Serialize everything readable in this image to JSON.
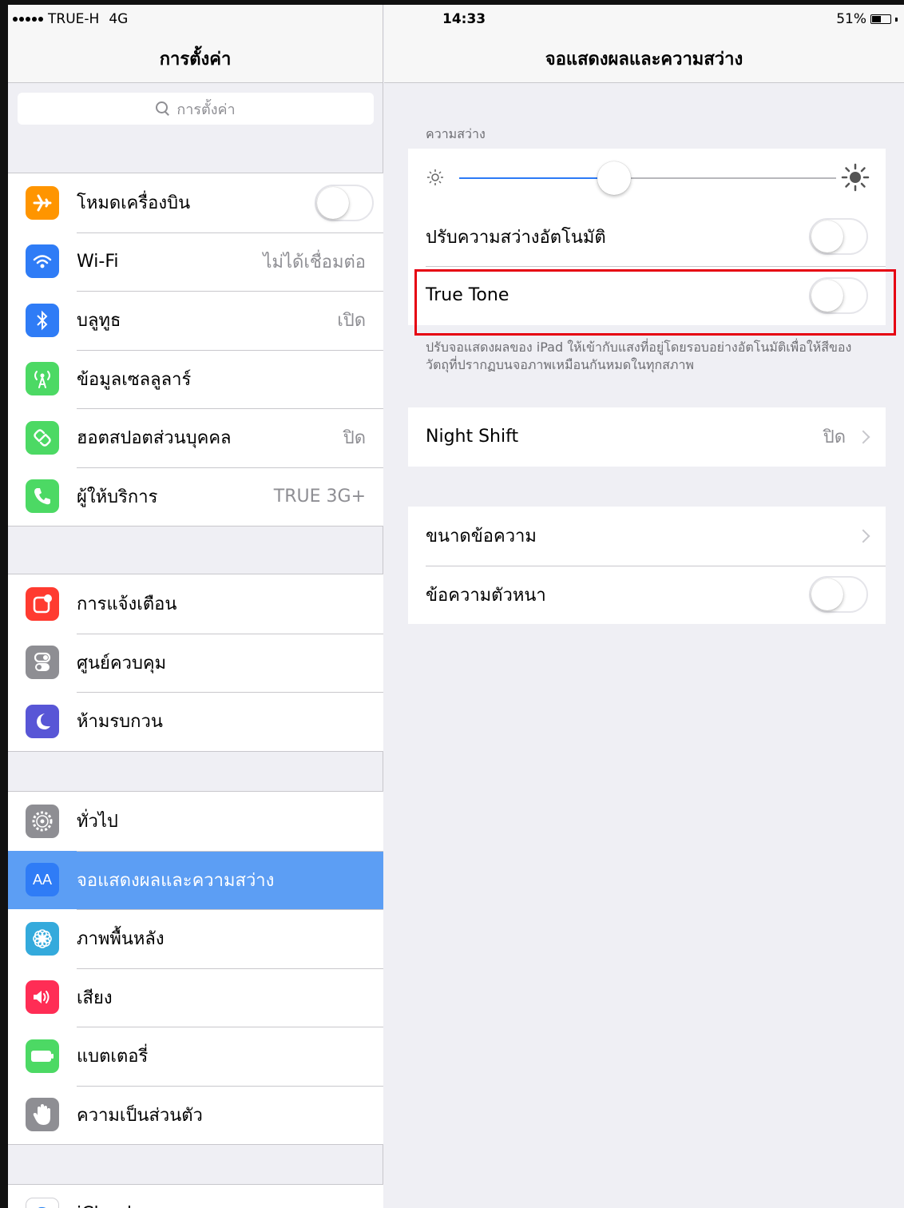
{
  "status_bar": {
    "carrier": "TRUE-H",
    "network": "4G",
    "time": "14:33",
    "battery": "51%",
    "battery_level": 0.51
  },
  "sidebar": {
    "title": "การตั้งค่า",
    "search_placeholder": "การตั้งค่า",
    "groups": [
      [
        {
          "label": "โหมดเครื่องบิน",
          "icon": "airplane-icon",
          "color": "#ff9500",
          "toggle": false
        },
        {
          "label": "Wi-Fi",
          "value": "ไม่ได้เชื่อมต่อ",
          "icon": "wifi-icon",
          "color": "#2f7cf6"
        },
        {
          "label": "บลูทูธ",
          "value": "เปิด",
          "icon": "bluetooth-icon",
          "color": "#2f7cf6"
        },
        {
          "label": "ข้อมูลเซลลูลาร์",
          "icon": "cellular-icon",
          "color": "#4cd964"
        },
        {
          "label": "ฮอตสปอตส่วนบุคคล",
          "value": "ปิด",
          "icon": "hotspot-icon",
          "color": "#4cd964"
        },
        {
          "label": "ผู้ให้บริการ",
          "value": "TRUE 3G+",
          "icon": "phone-icon",
          "color": "#4cd964"
        }
      ],
      [
        {
          "label": "การแจ้งเตือน",
          "icon": "notifications-icon",
          "color": "#ff3b30"
        },
        {
          "label": "ศูนย์ควบคุม",
          "icon": "control-center-icon",
          "color": "#8e8e93"
        },
        {
          "label": "ห้ามรบกวน",
          "icon": "moon-icon",
          "color": "#5856d6"
        }
      ],
      [
        {
          "label": "ทั่วไป",
          "icon": "gear-icon",
          "color": "#8e8e93"
        },
        {
          "label": "จอแสดงผลและความสว่าง",
          "icon": "display-icon",
          "color": "#2f7cf6",
          "selected": true,
          "glyph": "AA"
        },
        {
          "label": "ภาพพื้นหลัง",
          "icon": "wallpaper-icon",
          "color": "#34aadc"
        },
        {
          "label": "เสียง",
          "icon": "speaker-icon",
          "color": "#ff2d55"
        },
        {
          "label": "แบตเตอรี่",
          "icon": "battery-icon",
          "color": "#4cd964"
        },
        {
          "label": "ความเป็นส่วนตัว",
          "icon": "hand-icon",
          "color": "#8e8e93"
        }
      ],
      [
        {
          "label": "iCloud",
          "icon": "icloud-icon",
          "color": "#ffffff"
        }
      ]
    ]
  },
  "detail": {
    "title": "จอแสดงผลและความสว่าง",
    "brightness_header": "ความสว่าง",
    "brightness_level": 0.41,
    "auto_brightness": {
      "label": "ปรับความสว่างอัตโนมัติ",
      "on": false
    },
    "true_tone": {
      "label": "True Tone",
      "on": false
    },
    "true_tone_note": "ปรับจอแสดงผลของ iPad ให้เข้ากับแสงที่อยู่โดยรอบอย่างอัตโนมัติเพื่อให้สีของวัตถุที่ปรากฏบนจอภาพเหมือนกันหมดในทุกสภาพ",
    "night_shift": {
      "label": "Night Shift",
      "value": "ปิด"
    },
    "text_size": {
      "label": "ขนาดข้อความ"
    },
    "bold_text": {
      "label": "ข้อความตัวหนา",
      "on": false
    }
  }
}
